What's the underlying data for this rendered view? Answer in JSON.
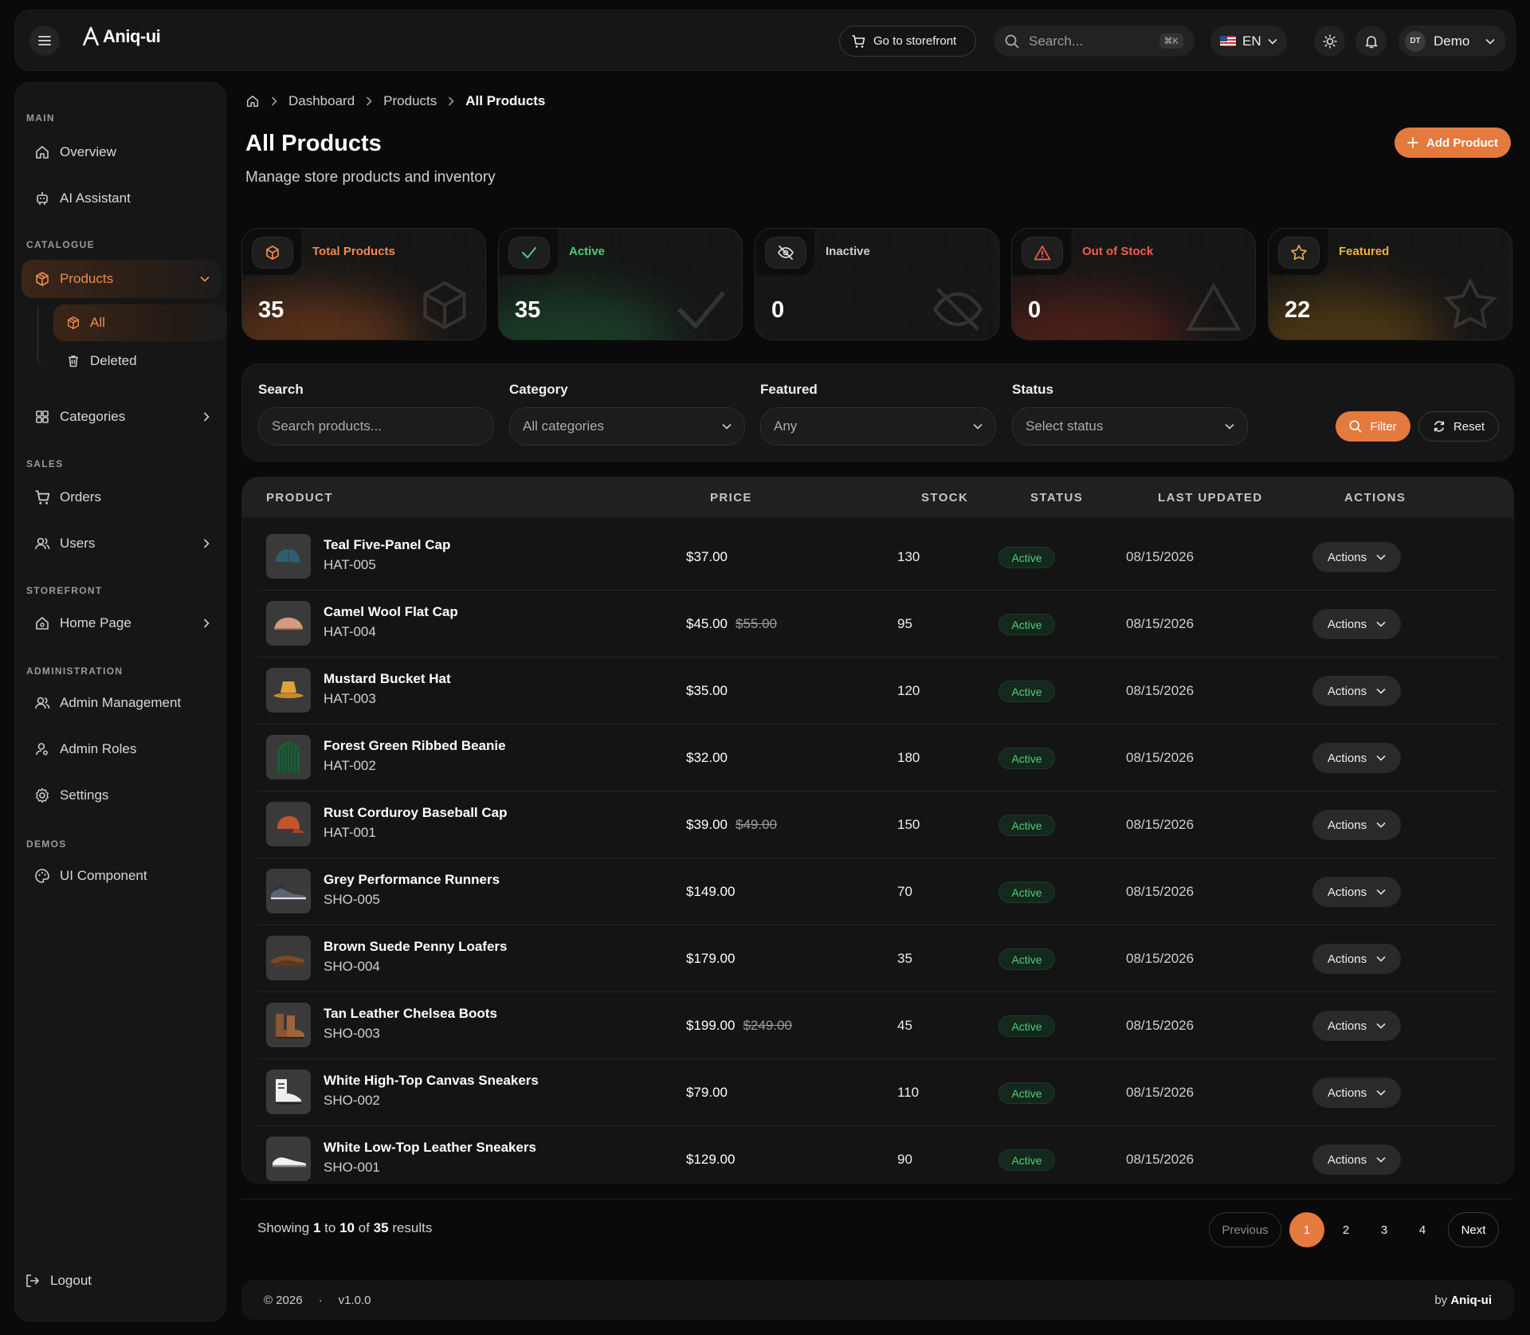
{
  "topbar": {
    "logo": "Aniq-ui",
    "storefront": "Go to storefront",
    "search_placeholder": "Search...",
    "search_kbd": "⌘K",
    "lang": "EN",
    "user_initials": "DT",
    "user_name": "Demo"
  },
  "sidebar": {
    "sections": {
      "main": "MAIN",
      "catalogue": "CATALOGUE",
      "sales": "SALES",
      "storefront": "STOREFRONT",
      "administration": "ADMINISTRATION",
      "demos": "DEMOS"
    },
    "items": {
      "overview": "Overview",
      "ai": "AI Assistant",
      "products": "Products",
      "all": "All",
      "deleted": "Deleted",
      "categories": "Categories",
      "orders": "Orders",
      "users": "Users",
      "home": "Home Page",
      "admin_mgmt": "Admin Management",
      "admin_roles": "Admin Roles",
      "settings": "Settings",
      "ui": "UI Component"
    },
    "logout": "Logout"
  },
  "breadcrumb": [
    "Dashboard",
    "Products",
    "All Products"
  ],
  "page": {
    "title": "All Products",
    "subtitle": "Manage store products and inventory",
    "add_button": "Add Product"
  },
  "stats": [
    {
      "label": "Total Products",
      "value": "35",
      "color": "#f28a4c"
    },
    {
      "label": "Active",
      "value": "35",
      "color": "#4ad07a"
    },
    {
      "label": "Inactive",
      "value": "0",
      "color": "#cfcfcf"
    },
    {
      "label": "Out of Stock",
      "value": "0",
      "color": "#f0604a"
    },
    {
      "label": "Featured",
      "value": "22",
      "color": "#f2b33c"
    }
  ],
  "filters": {
    "search_label": "Search",
    "search_placeholder": "Search products...",
    "category_label": "Category",
    "category_value": "All categories",
    "featured_label": "Featured",
    "featured_value": "Any",
    "status_label": "Status",
    "status_value": "Select status",
    "filter_btn": "Filter",
    "reset_btn": "Reset"
  },
  "table": {
    "headers": [
      "PRODUCT",
      "PRICE",
      "STOCK",
      "STATUS",
      "LAST UPDATED",
      "ACTIONS"
    ],
    "rows": [
      {
        "name": "Teal Five-Panel Cap",
        "sku": "HAT-005",
        "price": "$37.00",
        "old": "",
        "stock": "130",
        "status": "Active",
        "date": "08/15/2026",
        "action": "Actions",
        "img": "cap-teal"
      },
      {
        "name": "Camel Wool Flat Cap",
        "sku": "HAT-004",
        "price": "$45.00",
        "old": "$55.00",
        "stock": "95",
        "status": "Active",
        "date": "08/15/2026",
        "action": "Actions",
        "img": "cap-camel"
      },
      {
        "name": "Mustard Bucket Hat",
        "sku": "HAT-003",
        "price": "$35.00",
        "old": "",
        "stock": "120",
        "status": "Active",
        "date": "08/15/2026",
        "action": "Actions",
        "img": "bucket-hat"
      },
      {
        "name": "Forest Green Ribbed Beanie",
        "sku": "HAT-002",
        "price": "$32.00",
        "old": "",
        "stock": "180",
        "status": "Active",
        "date": "08/15/2026",
        "action": "Actions",
        "img": "beanie"
      },
      {
        "name": "Rust Corduroy Baseball Cap",
        "sku": "HAT-001",
        "price": "$39.00",
        "old": "$49.00",
        "stock": "150",
        "status": "Active",
        "date": "08/15/2026",
        "action": "Actions",
        "img": "cap-rust"
      },
      {
        "name": "Grey Performance Runners",
        "sku": "SHO-005",
        "price": "$149.00",
        "old": "",
        "stock": "70",
        "status": "Active",
        "date": "08/15/2026",
        "action": "Actions",
        "img": "runners"
      },
      {
        "name": "Brown Suede Penny Loafers",
        "sku": "SHO-004",
        "price": "$179.00",
        "old": "",
        "stock": "35",
        "status": "Active",
        "date": "08/15/2026",
        "action": "Actions",
        "img": "loafers"
      },
      {
        "name": "Tan Leather Chelsea Boots",
        "sku": "SHO-003",
        "price": "$199.00",
        "old": "$249.00",
        "stock": "45",
        "status": "Active",
        "date": "08/15/2026",
        "action": "Actions",
        "img": "boots"
      },
      {
        "name": "White High-Top Canvas Sneakers",
        "sku": "SHO-002",
        "price": "$79.00",
        "old": "",
        "stock": "110",
        "status": "Active",
        "date": "08/15/2026",
        "action": "Actions",
        "img": "hightop"
      },
      {
        "name": "White Low-Top Leather Sneakers",
        "sku": "SHO-001",
        "price": "$129.00",
        "old": "",
        "stock": "90",
        "status": "Active",
        "date": "08/15/2026",
        "action": "Actions",
        "img": "lowtop"
      }
    ]
  },
  "pagination": {
    "showing_prefix": "Showing",
    "from": "1",
    "to_word": "to",
    "to": "10",
    "of_word": "of",
    "total": "35",
    "suffix": "results",
    "previous": "Previous",
    "pages": [
      "1",
      "2",
      "3",
      "4"
    ],
    "next": "Next"
  },
  "footer": {
    "copyright": "© 2026",
    "version": "v1.0.0",
    "by": "by",
    "brand": "Aniq-ui"
  }
}
